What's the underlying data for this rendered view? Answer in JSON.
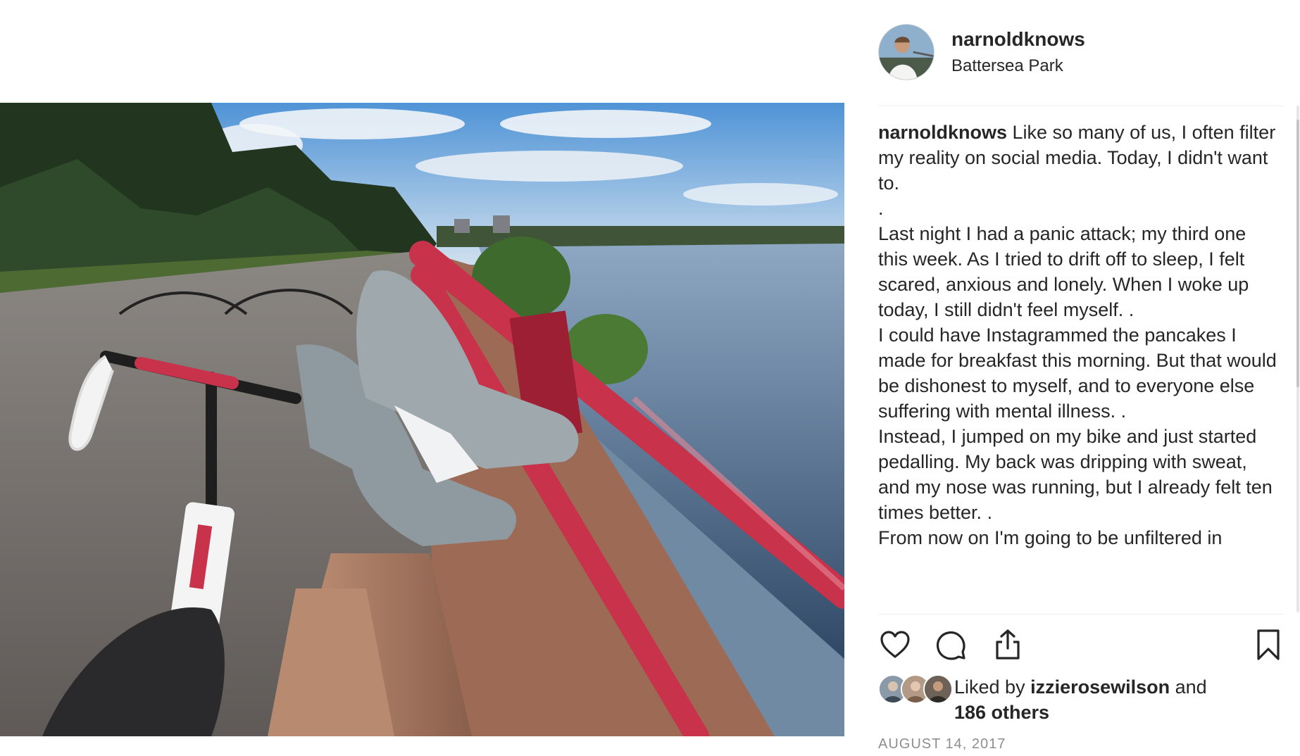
{
  "post": {
    "username": "narnoldknows",
    "location": "Battersea Park",
    "caption_user": "narnoldknows",
    "caption_text": " Like so many of us, I often filter my reality on social media. Today, I didn't want to.\n.\nLast night I had a panic attack; my third one this week. As I tried to drift off to sleep, I felt scared, anxious and lonely. When I woke up today, I still didn't feel myself. .\nI could have Instagrammed the pancakes I made for breakfast this morning. But that would be dishonest to myself, and to everyone else suffering with mental illness. .\nInstead, I jumped on my bike and just started pedalling. My back was dripping with sweat, and my nose was running, but I already felt ten times better. .\nFrom now on I'm going to be unfiltered in",
    "likes_prefix": "Liked by ",
    "liked_by_user": "izzierosewilson",
    "likes_and": " and",
    "likes_others": "186 others",
    "date": "AUGUST 14, 2017"
  },
  "icons": {
    "like": "heart-icon",
    "comment": "comment-icon",
    "share": "share-icon",
    "save": "bookmark-icon"
  },
  "colors": {
    "text": "#262626",
    "muted": "#8e8e8e",
    "divider": "#efefef",
    "railing": "#c8324a"
  }
}
